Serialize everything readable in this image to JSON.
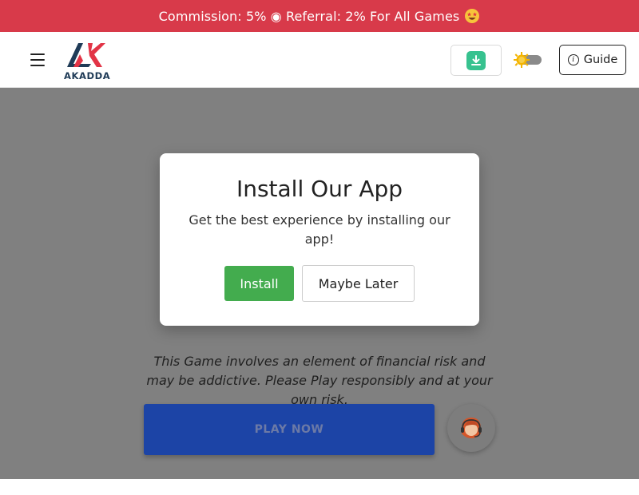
{
  "promo": {
    "text": "Commission: 5% ◉ Referral: 2% For All Games",
    "emoji_icon": "star-struck-emoji-icon"
  },
  "header": {
    "menu_icon": "hamburger-menu-icon",
    "logo_text": "AKADDA",
    "download_icon": "download-icon",
    "theme_icon": "sun-icon",
    "guide_label": "Guide",
    "guide_icon": "info-icon"
  },
  "main": {
    "disclaimer": "This Game involves an element of financial risk and may be addictive. Please Play responsibly and at your own risk.",
    "play_now_label": "PLAY NOW",
    "support_icon": "support-agent-avatar-icon"
  },
  "modal": {
    "title": "Install Our App",
    "subtitle": "Get the best experience by installing our app!",
    "install_label": "Install",
    "later_label": "Maybe Later"
  },
  "colors": {
    "promo_bg": "#d83a4a",
    "overlay": "#808080",
    "install_green": "#43ac4e",
    "play_blue": "#1c44a6",
    "download_green": "#37c28f",
    "logo_red": "#e23446",
    "logo_navy": "#1f3b57"
  }
}
